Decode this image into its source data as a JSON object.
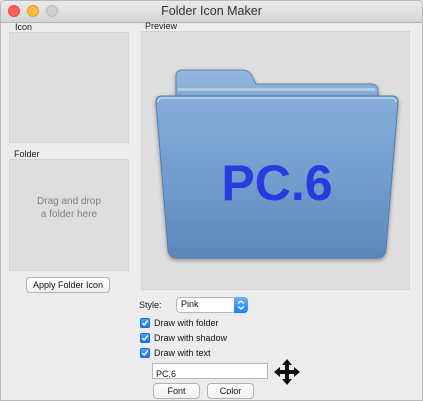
{
  "window": {
    "title": "Folder Icon Maker"
  },
  "labels": {
    "icon": "Icon",
    "folder": "Folder",
    "preview": "Preview",
    "style": "Style:"
  },
  "folder_drop": {
    "text": "Drag and drop\na folder here"
  },
  "buttons": {
    "apply": "Apply Folder Icon",
    "font": "Font",
    "color": "Color"
  },
  "style_select": {
    "value": "Pink"
  },
  "checkboxes": [
    {
      "label": "Draw with folder",
      "checked": true
    },
    {
      "label": "Draw with shadow",
      "checked": true
    },
    {
      "label": "Draw with text",
      "checked": true
    }
  ],
  "text_field": {
    "value": "PC.6"
  },
  "preview": {
    "folder_text": "PC.6",
    "text_color": "#2b3ae0",
    "folder_color": "#7aa4cf"
  },
  "icons": {
    "move": "move-arrows-icon",
    "dropdown": "chevron-updown-icon"
  }
}
